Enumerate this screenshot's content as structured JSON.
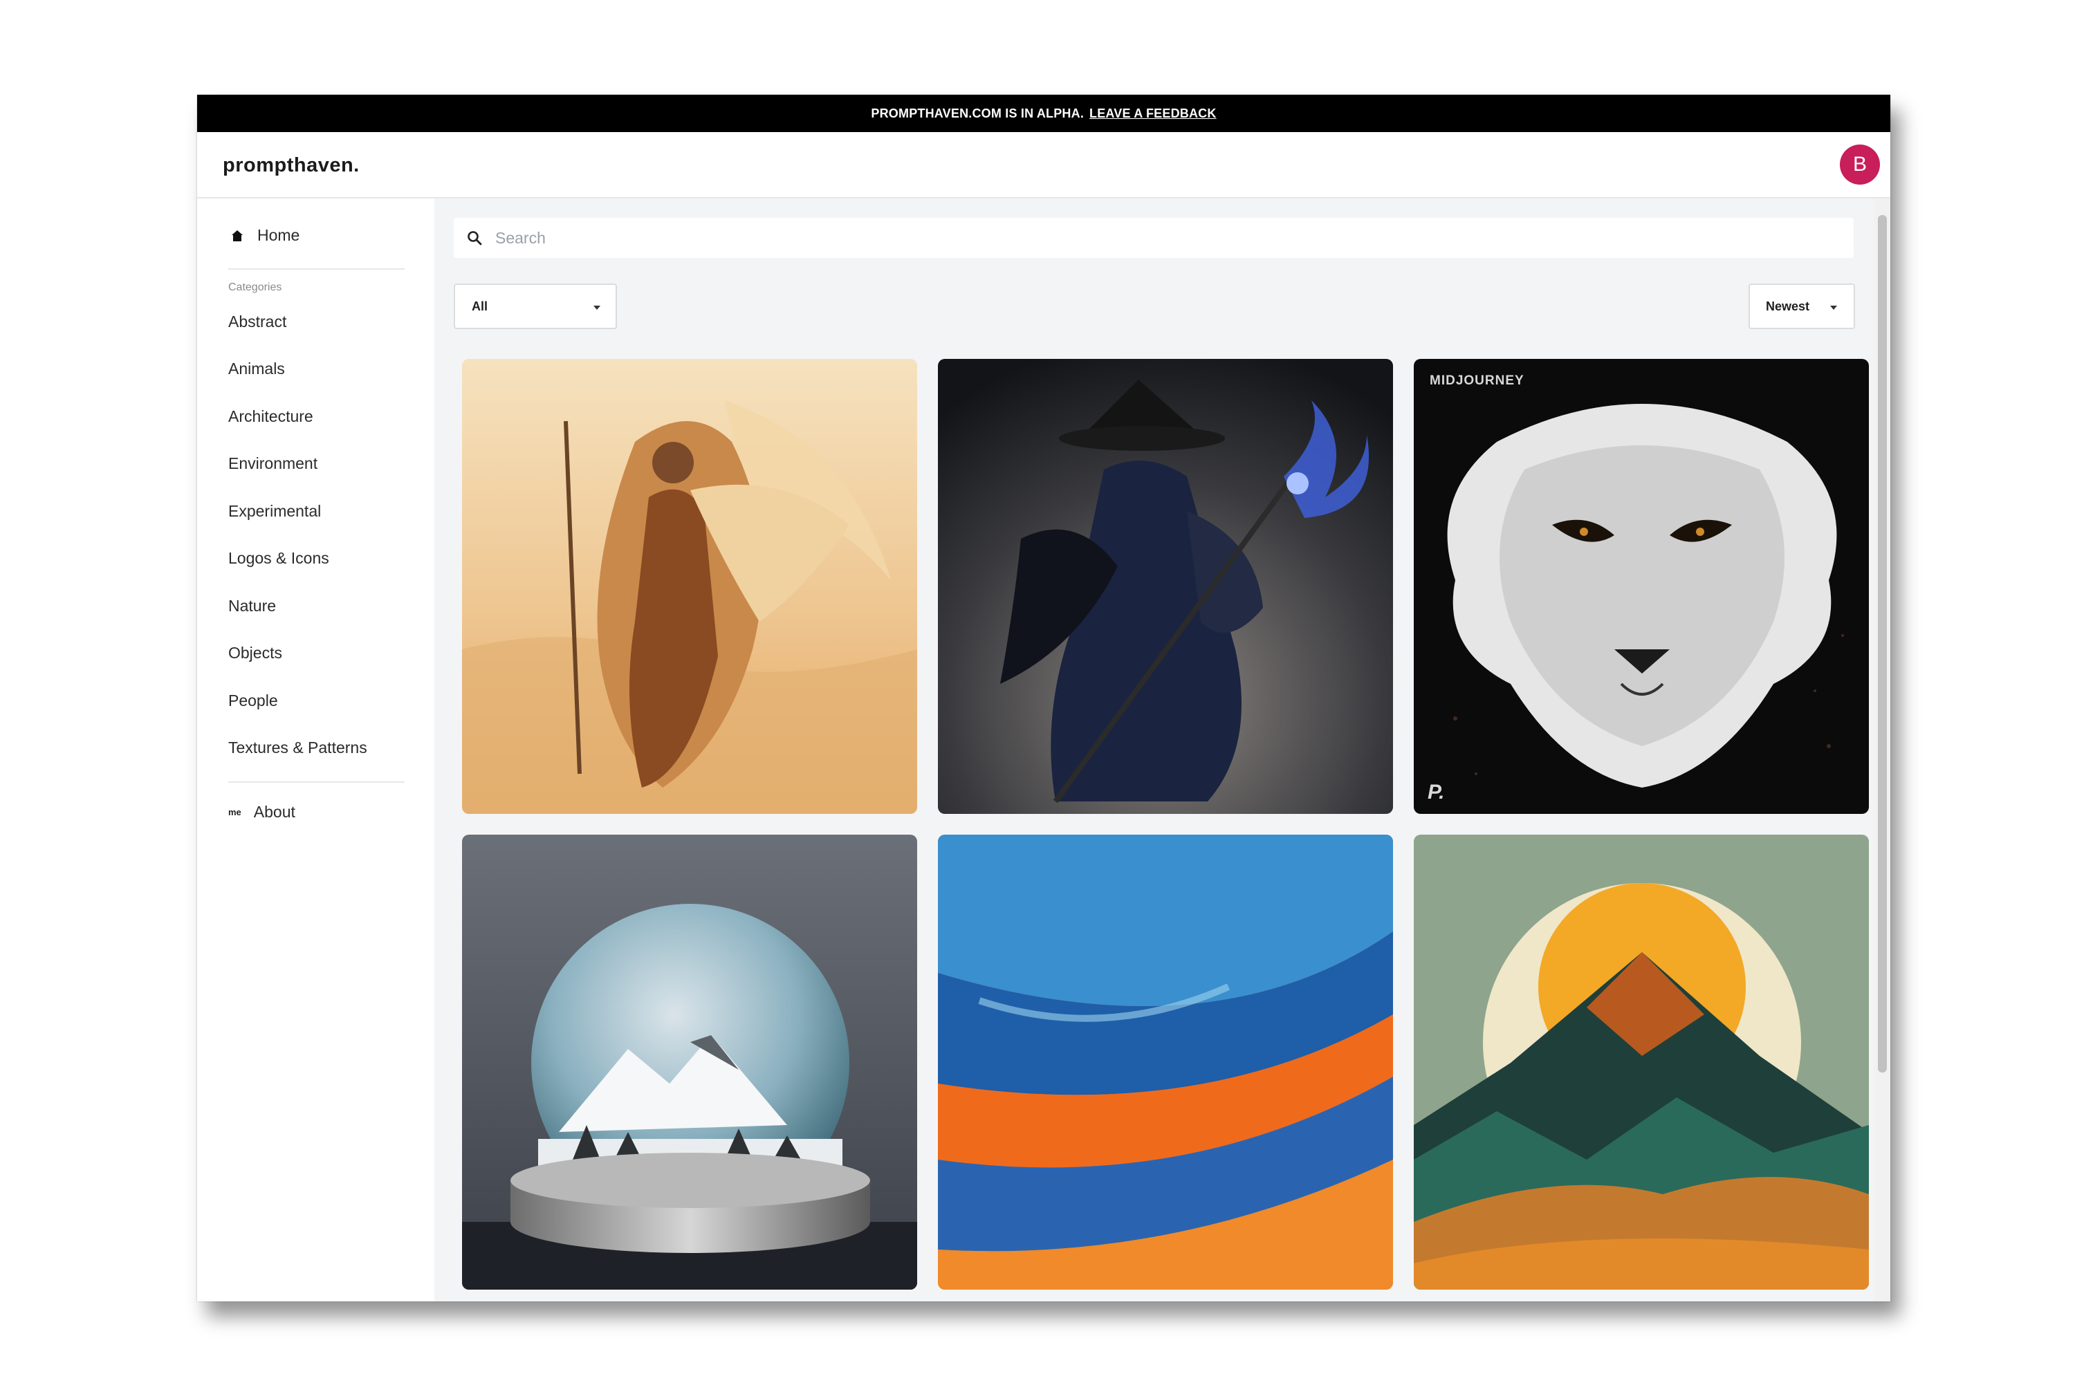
{
  "banner": {
    "text": "PROMPTHAVEN.COM IS IN ALPHA.",
    "link": "LEAVE A FEEDBACK"
  },
  "header": {
    "logo": "prompthaven.",
    "avatar_letter": "B"
  },
  "sidebar": {
    "home": "Home",
    "categories_heading": "Categories",
    "categories": [
      "Abstract",
      "Animals",
      "Architecture",
      "Environment",
      "Experimental",
      "Logos & Icons",
      "Nature",
      "Objects",
      "People",
      "Textures & Patterns"
    ],
    "about_icon": "me",
    "about": "About"
  },
  "search": {
    "placeholder": "Search",
    "value": ""
  },
  "filters": {
    "filter_selected": "All",
    "sort_selected": "Newest"
  },
  "gallery": [
    {
      "subject": "warrior woman in desert",
      "watermark": ""
    },
    {
      "subject": "dark sorcerer with staff",
      "watermark": ""
    },
    {
      "subject": "white lion face",
      "watermark": "MIDJOURNEY",
      "badge": "P."
    },
    {
      "subject": "snow globe with mountains",
      "watermark": ""
    },
    {
      "subject": "abstract orange and blue waves",
      "watermark": ""
    },
    {
      "subject": "mountain with sun",
      "watermark": ""
    }
  ],
  "colors": {
    "banner": "#000000",
    "avatar": "#c81e5a",
    "main_background": "#f3f4f6"
  }
}
